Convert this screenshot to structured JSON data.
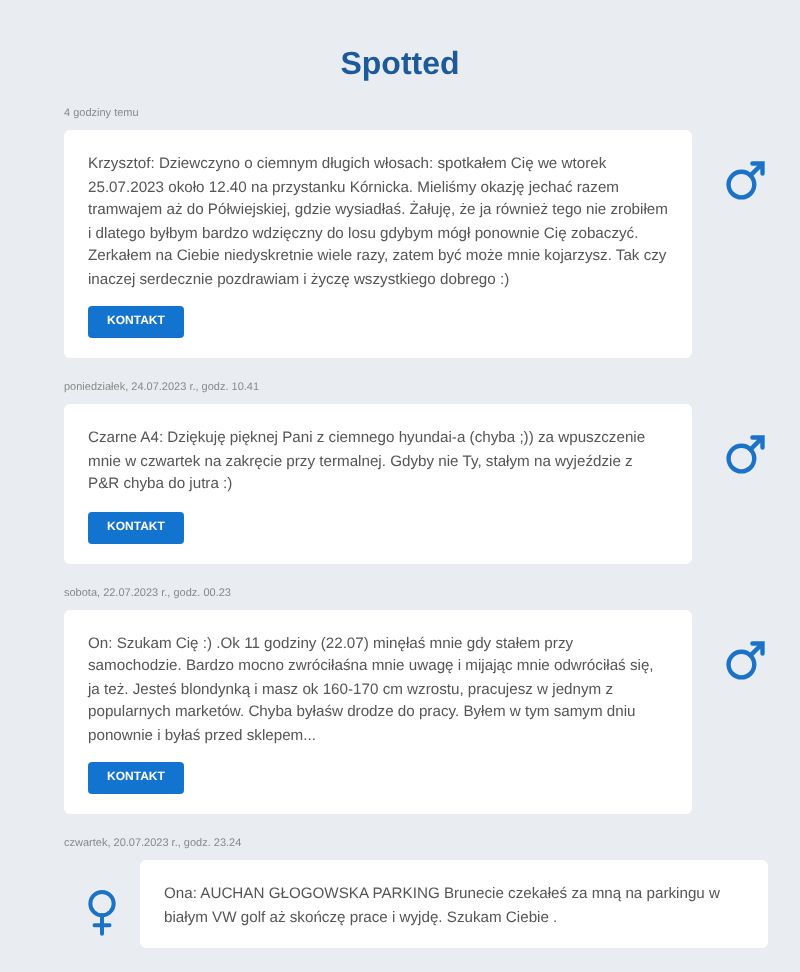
{
  "title": "Spotted",
  "posts": [
    {
      "date": "4 godziny temu",
      "kind": "male",
      "text": "Krzysztof: Dziewczyno o ciemnym długich włosach: spotkałem Cię we wtorek 25.07.2023 około 12.40 na przystanku Kórnicka. Mieliśmy okazję jechać razem tramwajem aż do Półwiejskiej, gdzie wysiadłaś. Żałuję, że ja również tego nie zrobiłem i dlatego byłbym bardzo wdzięczny do losu gdybym mógł ponownie Cię zobaczyć. Zerkałem na Ciebie niedyskretnie wiele razy, zatem być może mnie kojarzysz. Tak czy inaczej serdecznie pozdrawiam i życzę wszystkiego dobrego :)",
      "button": "KONTAKT"
    },
    {
      "date": "poniedziałek, 24.07.2023 r., godz. 10.41",
      "kind": "male",
      "text": "Czarne A4: Dziękuję pięknej Pani z ciemnego hyundai-a (chyba ;)) za wpuszczenie mnie w czwartek na zakręcie przy termalnej. Gdyby nie Ty, stałym na wyjeździe z P&R chyba do jutra :)",
      "button": "KONTAKT"
    },
    {
      "date": "sobota, 22.07.2023 r., godz. 00.23",
      "kind": "male",
      "text": "On: Szukam Cię :) .Ok 11 godziny (22.07) minęłaś mnie gdy stałem przy samochodzie. Bardzo mocno zwróciłaśna mnie uwagę i mijając mnie odwróciłaś się, ja też. Jesteś blondynką i masz ok 160-170 cm wzrostu, pracujesz w jednym z popularnych marketów. Chyba byłaśw drodze do pracy. Byłem w tym samym dniu ponownie i byłaś przed sklepem...",
      "button": "KONTAKT"
    },
    {
      "date": "czwartek, 20.07.2023 r., godz. 23.24",
      "kind": "female",
      "text": "Ona: AUCHAN GŁOGOWSKA PARKING Brunecie czekałeś za mną na parkingu w białym VW golf aż skończę prace i wyjdę. Szukam Ciebie ."
    }
  ]
}
